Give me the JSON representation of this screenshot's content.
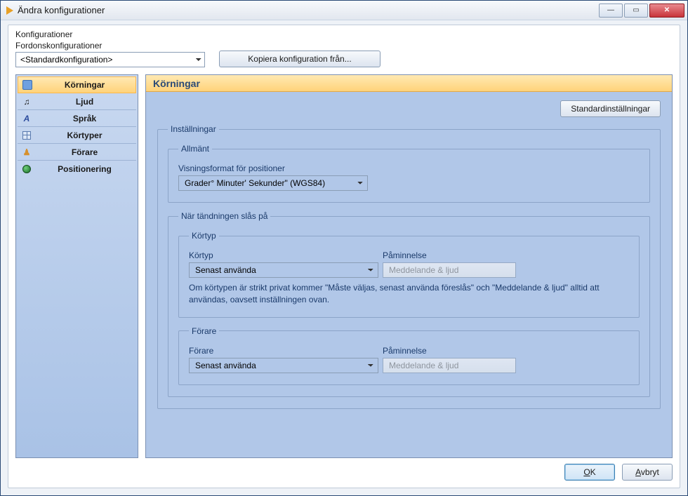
{
  "window": {
    "title": "Ändra konfigurationer"
  },
  "topbar": {
    "konfig_label": "Konfigurationer",
    "vehicle_label": "Fordonskonfigurationer",
    "vehicle_selected": "<Standardkonfiguration>",
    "copy_button": "Kopiera konfiguration från..."
  },
  "sidebar": {
    "items": [
      {
        "label": "Körningar"
      },
      {
        "label": "Ljud"
      },
      {
        "label": "Språk"
      },
      {
        "label": "Körtyper"
      },
      {
        "label": "Förare"
      },
      {
        "label": "Positionering"
      }
    ]
  },
  "content": {
    "title": "Körningar",
    "defaults_button": "Standardinställningar",
    "settings_legend": "Inställningar",
    "general_legend": "Allmänt",
    "pos_format_label": "Visningsformat för positioner",
    "pos_format_value": "Grader° Minuter' Sekunder\" (WGS84)",
    "ignition_legend": "När tändningen slås på",
    "kortyp_legend": "Körtyp",
    "kortyp_label": "Körtyp",
    "kortyp_value": "Senast använda",
    "reminder_label": "Påminnelse",
    "reminder_value": "Meddelande & ljud",
    "kortyp_note": "Om körtypen är strikt privat kommer \"Måste väljas, senast använda föreslås\" och \"Meddelande & ljud\" alltid att användas, oavsett inställningen ovan.",
    "driver_legend": "Förare",
    "driver_label": "Förare",
    "driver_value": "Senast använda",
    "driver_reminder_label": "Påminnelse",
    "driver_reminder_value": "Meddelande & ljud"
  },
  "footer": {
    "ok": "OK",
    "cancel": "Avbryt"
  }
}
